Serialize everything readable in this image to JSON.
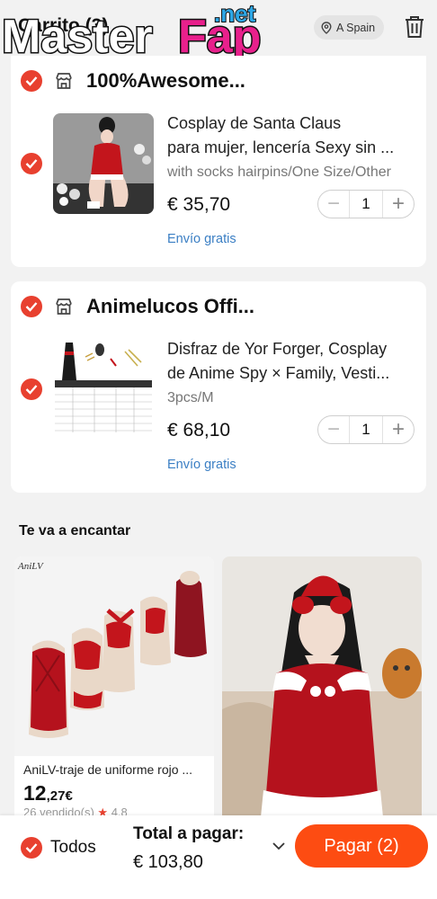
{
  "header": {
    "title": "Carrito (3)",
    "watermark_text": "MasterFap",
    "watermark_net": ".net",
    "location": "A Spain"
  },
  "stores": [
    {
      "name": "100%Awesome...",
      "products": [
        {
          "title": "Cosplay de Santa Claus",
          "title_line2": "para mujer, lencería Sexy sin ...",
          "variant": "with socks hairpins/One Size/Other",
          "price": "€ 35,70",
          "qty": "1",
          "shipping": "Envío gratis"
        }
      ]
    },
    {
      "name": "Animelucos Offi...",
      "products": [
        {
          "title": "Disfraz de Yor Forger, Cosplay",
          "title_line2": "de Anime Spy × Family, Vesti...",
          "variant": "3pcs/M",
          "price": "€ 68,10",
          "qty": "1",
          "shipping": "Envío gratis"
        }
      ]
    }
  ],
  "recommendations": {
    "title": "Te va a encantar",
    "items": [
      {
        "brand": "AniLV",
        "name": "AniLV-traje de uniforme rojo ...",
        "price_int": "12",
        "price_dec": ",27€",
        "sold": "26 vendido(s)",
        "rating": "4,8"
      },
      {
        "name": "",
        "price_int": "",
        "price_dec": "",
        "sold": "",
        "rating": ""
      }
    ]
  },
  "bottom": {
    "select_all": "Todos",
    "total_label": "Total a pagar:",
    "total_value": "€ 103,80",
    "pay_button": "Pagar (2)"
  },
  "colors": {
    "accent": "#fd4c12",
    "check": "#e8402f",
    "link": "#3b7fc4",
    "watermark_pink": "#e8208c",
    "watermark_blue": "#2da7e6"
  },
  "icons": [
    "back-icon",
    "location-pin-icon",
    "trash-icon",
    "check-icon",
    "store-icon",
    "minus-icon",
    "plus-icon",
    "chevron-down-icon",
    "star-icon"
  ]
}
